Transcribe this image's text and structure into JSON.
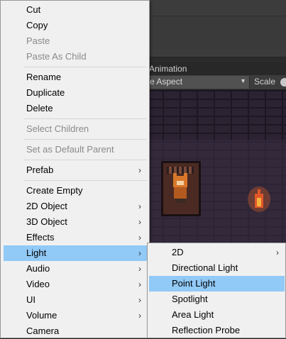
{
  "editor": {
    "tab_title": "Animation",
    "aspect_value": "e Aspect",
    "scale_label": "Scale"
  },
  "context_menu": {
    "items": [
      {
        "label": "Cut",
        "disabled": false
      },
      {
        "label": "Copy",
        "disabled": false
      },
      {
        "label": "Paste",
        "disabled": true
      },
      {
        "label": "Paste As Child",
        "disabled": true
      },
      {
        "label": "Rename",
        "disabled": false
      },
      {
        "label": "Duplicate",
        "disabled": false
      },
      {
        "label": "Delete",
        "disabled": false
      },
      {
        "label": "Select Children",
        "disabled": true
      },
      {
        "label": "Set as Default Parent",
        "disabled": true
      },
      {
        "label": "Prefab",
        "disabled": false,
        "submenu": true
      },
      {
        "label": "Create Empty",
        "disabled": false
      },
      {
        "label": "2D Object",
        "disabled": false,
        "submenu": true
      },
      {
        "label": "3D Object",
        "disabled": false,
        "submenu": true
      },
      {
        "label": "Effects",
        "disabled": false,
        "submenu": true
      },
      {
        "label": "Light",
        "disabled": false,
        "submenu": true,
        "highlighted": true
      },
      {
        "label": "Audio",
        "disabled": false,
        "submenu": true
      },
      {
        "label": "Video",
        "disabled": false,
        "submenu": true
      },
      {
        "label": "UI",
        "disabled": false,
        "submenu": true
      },
      {
        "label": "Volume",
        "disabled": false,
        "submenu": true
      },
      {
        "label": "Camera",
        "disabled": false
      }
    ]
  },
  "light_submenu": {
    "items": [
      {
        "label": "2D",
        "submenu": true
      },
      {
        "label": "Directional Light"
      },
      {
        "label": "Point Light",
        "highlighted": true
      },
      {
        "label": "Spotlight"
      },
      {
        "label": "Area Light"
      },
      {
        "label": "Reflection Probe"
      }
    ]
  },
  "icons": {
    "submenu_arrow": "chevron-right-icon",
    "dropdown_arrow": "caret-down-icon"
  },
  "colors": {
    "menu_background": "#f0f0f0",
    "highlight": "#91c9f7",
    "disabled_text": "#8a8a8a",
    "editor_background": "#2b2b2b"
  }
}
